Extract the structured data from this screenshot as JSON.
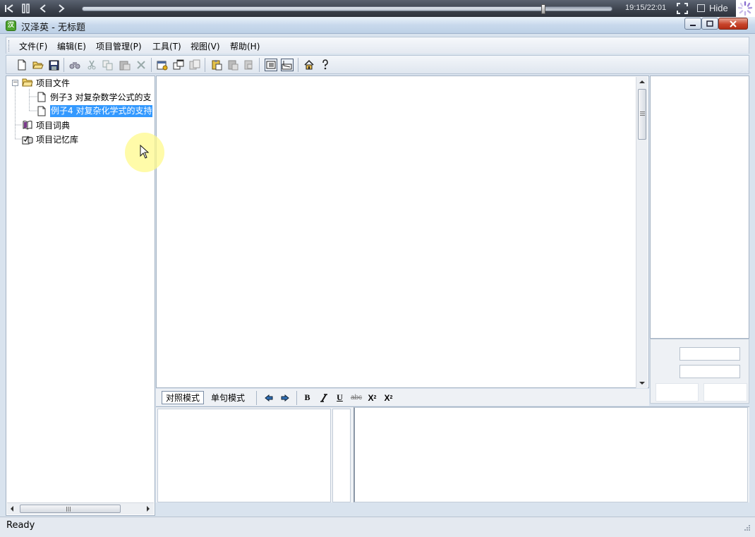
{
  "player": {
    "time": "19:15/22:01",
    "hide_label": "Hide",
    "progress": 0.87
  },
  "window": {
    "title": "汉泽英 - 无标题",
    "icon_glyph": "汉"
  },
  "menu": [
    {
      "label": "文件(F)"
    },
    {
      "label": "编辑(E)"
    },
    {
      "label": "项目管理(P)"
    },
    {
      "label": "工具(T)"
    },
    {
      "label": "视图(V)"
    },
    {
      "label": "帮助(H)"
    }
  ],
  "tree": {
    "root": "项目文件",
    "files": [
      "例子3  对复杂数学公式的支",
      "例子4  对复杂化学式的支持"
    ],
    "dictionary": "项目词典",
    "memory": "项目记忆库"
  },
  "format_bar": {
    "tab_compare": "对照模式",
    "tab_sentence": "单句模式",
    "bold": "B",
    "italic": "I",
    "underline": "U",
    "strike": "abc",
    "superscript": "X",
    "subscript": "X",
    "sup_mark": "2",
    "sub_mark": "2"
  },
  "status": {
    "text": "Ready"
  },
  "colors": {
    "selection": "#3399ff",
    "close_button": "#c8442b"
  }
}
